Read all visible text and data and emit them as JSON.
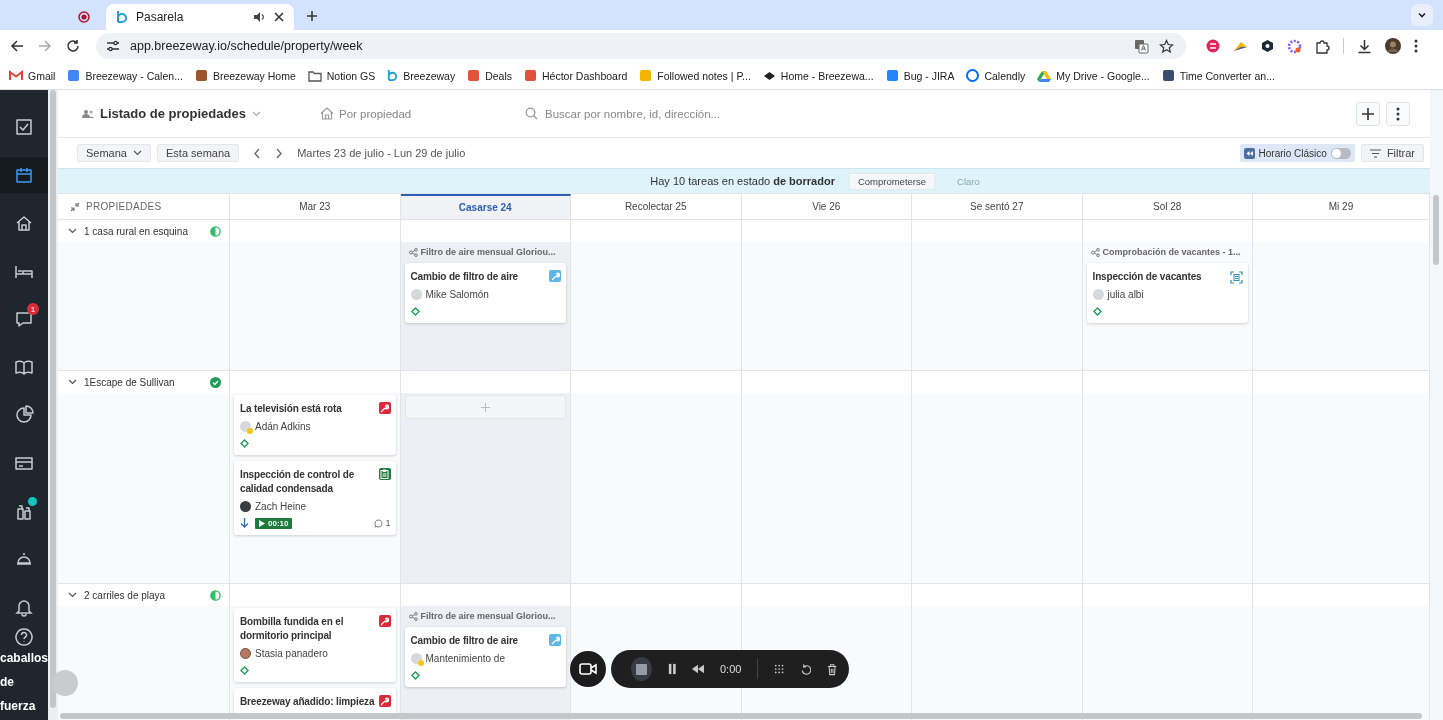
{
  "browser": {
    "tabs": [
      {
        "kind": "recording",
        "selected": false
      },
      {
        "kind": "page",
        "title": "Pasarela",
        "selected": true
      }
    ],
    "url": "app.breezeway.io/schedule/property/week",
    "bookmarks": [
      {
        "kind": "gmail",
        "label": "Gmail"
      },
      {
        "kind": "calendar",
        "label": "Breezeway - Calen..."
      },
      {
        "kind": "house",
        "label": "Breezeway Home"
      },
      {
        "kind": "folder",
        "label": "Notion GS"
      },
      {
        "kind": "breezeway",
        "label": "Breezeway"
      },
      {
        "kind": "hub",
        "label": "Deals"
      },
      {
        "kind": "hub",
        "label": "Héctor Dashboard"
      },
      {
        "kind": "arrow",
        "label": "Followed notes | P..."
      },
      {
        "kind": "diamond",
        "label": "Home - Breezewa..."
      },
      {
        "kind": "jira",
        "label": "Bug - JIRA"
      },
      {
        "kind": "calendly",
        "label": "Calendly"
      },
      {
        "kind": "drive",
        "label": "My Drive - Google..."
      },
      {
        "kind": "doc",
        "label": "Time Converter an..."
      }
    ]
  },
  "sidebar": {
    "items": [
      {
        "kind": "tasks",
        "selected": false,
        "dot": false
      },
      {
        "kind": "calendar",
        "selected": true,
        "dot": false
      },
      {
        "kind": "home",
        "selected": false,
        "dot": false
      },
      {
        "kind": "bed",
        "selected": false,
        "dot": false
      },
      {
        "kind": "chat",
        "selected": false,
        "dot": false,
        "badge": "1"
      },
      {
        "kind": "book",
        "selected": false,
        "dot": false
      },
      {
        "kind": "pie",
        "selected": false,
        "dot": false
      },
      {
        "kind": "card",
        "selected": false,
        "dot": false
      },
      {
        "kind": "bottles",
        "selected": false,
        "dot": true
      },
      {
        "kind": "concierge",
        "selected": false,
        "dot": false
      }
    ],
    "bottom": [
      {
        "kind": "bell"
      },
      {
        "kind": "help"
      }
    ],
    "user_label": "caballos de fuerza"
  },
  "header": {
    "view_title": "Listado de propiedades",
    "group_by": "Por propiedad",
    "search": {
      "placeholder": "Buscar por nombre, id, dirección..."
    }
  },
  "toolbar": {
    "period": "Semana",
    "today": "Esta semana",
    "range": "Martes 23 de julio - Lun 29 de julio",
    "classic": {
      "label": "Horario Clásico",
      "on": false
    },
    "filter": "Filtrar"
  },
  "banner": {
    "text": "Hay 10 tareas en estado **de borrador**",
    "commit": "Comprometerse",
    "clear": "Claro"
  },
  "columns": [
    {
      "label": "PROPIEDADES",
      "selected": false
    },
    {
      "label": "Mar 23",
      "selected": false
    },
    {
      "label": "Casarse 24",
      "selected": true
    },
    {
      "label": "Recolectar 25",
      "selected": false
    },
    {
      "label": "Vie 26",
      "selected": false
    },
    {
      "label": "Se sentó 27",
      "selected": false
    },
    {
      "label": "Sol 28",
      "selected": false
    },
    {
      "label": "Mi 29",
      "selected": false
    }
  ],
  "rows": [
    {
      "name": "1 casa rural en esquina",
      "complete": false,
      "expanded": true,
      "cells": [
        {},
        {
          "group": "Filtro de aire mensual Gloriou...",
          "cards": [
            {
              "title": "Cambio de filtro de aire",
              "kind": "filter",
              "assignee": "Mike Salomón",
              "avatar": {
                "kind": "initials",
                "away": false
              },
              "arrow": false
            }
          ]
        },
        {},
        {},
        {},
        {
          "group": "Comprobación de vacantes - 1...",
          "cards": [
            {
              "title": "Inspección de vacantes",
              "kind": "vacancy",
              "assignee": "julia albi",
              "avatar": {
                "kind": "initials",
                "away": false
              },
              "arrow": false
            }
          ]
        },
        {}
      ]
    },
    {
      "name": "1Escape de Sullivan",
      "complete": true,
      "expanded": true,
      "cells": [
        {
          "cards": [
            {
              "title": "La televisión está rota",
              "kind": "repair",
              "assignee": "Adán Adkins",
              "avatar": {
                "kind": "initials",
                "away": true
              },
              "arrow": false
            },
            {
              "title": "Inspección de control de calidad condensada",
              "kind": "inspection",
              "assignee": "Zach Heine",
              "avatar": {
                "kind": "dark",
                "away": false
              },
              "arrow": true,
              "timer": "00:10",
              "comments": "1"
            }
          ]
        },
        {
          "add_slot": true
        },
        {},
        {},
        {},
        {},
        {}
      ]
    },
    {
      "name": "2 carriles de playa",
      "complete": false,
      "expanded": true,
      "cells": [
        {
          "cards": [
            {
              "title": "Bombilla fundida en el dormitorio principal",
              "kind": "repair",
              "assignee": "Stasia panadero",
              "avatar": {
                "kind": "photo",
                "away": false
              },
              "arrow": false
            },
            {
              "title": "Breezeway añadido: limpieza",
              "kind": "repair"
            }
          ]
        },
        {
          "group": "Filtro de aire mensual Gloriou...",
          "cards": [
            {
              "title": "Cambio de filtro de aire",
              "kind": "filter",
              "assignee": "Mantenimiento de",
              "avatar": {
                "kind": "initials",
                "away": true
              },
              "arrow": false
            }
          ]
        },
        {},
        {},
        {},
        {},
        {}
      ]
    }
  ],
  "recorder": {
    "time": "0:00"
  }
}
